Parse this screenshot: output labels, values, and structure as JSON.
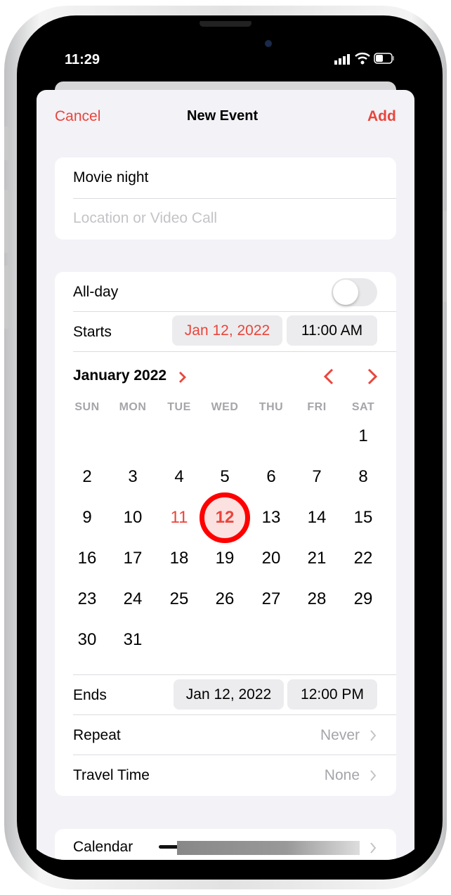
{
  "status": {
    "time": "11:29"
  },
  "nav": {
    "cancel": "Cancel",
    "title": "New Event",
    "add": "Add"
  },
  "event": {
    "title_value": "Movie night",
    "location_placeholder": "Location or Video Call"
  },
  "allday": {
    "label": "All-day",
    "on": false
  },
  "starts": {
    "label": "Starts",
    "date": "Jan 12, 2022",
    "time": "11:00 AM"
  },
  "calendar": {
    "month": "January 2022",
    "weekdays": [
      "SUN",
      "MON",
      "TUE",
      "WED",
      "THU",
      "FRI",
      "SAT"
    ],
    "days": [
      "1",
      "2",
      "3",
      "4",
      "5",
      "6",
      "7",
      "8",
      "9",
      "10",
      "11",
      "12",
      "13",
      "14",
      "15",
      "16",
      "17",
      "18",
      "19",
      "20",
      "21",
      "22",
      "23",
      "24",
      "25",
      "26",
      "27",
      "28",
      "29",
      "30",
      "31"
    ],
    "first_weekday": 6,
    "today": "11",
    "selected": "12"
  },
  "ends": {
    "label": "Ends",
    "date": "Jan 12, 2022",
    "time": "12:00 PM"
  },
  "repeat": {
    "label": "Repeat",
    "value": "Never"
  },
  "travel": {
    "label": "Travel Time",
    "value": "None"
  },
  "calendar_row": {
    "label": "Calendar"
  },
  "colors": {
    "accent": "#e9453b",
    "background": "#f2f2f7"
  }
}
